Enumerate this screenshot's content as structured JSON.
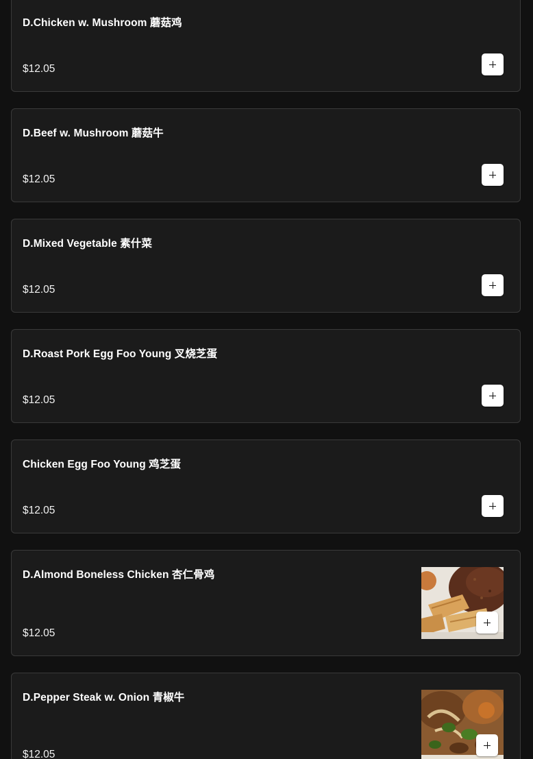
{
  "items": [
    {
      "name": "D.Chicken w. Mushroom 蘑菇鸡",
      "price": "$12.05",
      "has_image": false
    },
    {
      "name": "D.Beef w. Mushroom 蘑菇牛",
      "price": "$12.05",
      "has_image": false
    },
    {
      "name": "D.Mixed Vegetable 素什菜",
      "price": "$12.05",
      "has_image": false
    },
    {
      "name": "D.Roast Pork Egg Foo Young 叉烧芝蛋",
      "price": "$12.05",
      "has_image": false
    },
    {
      "name": "Chicken Egg Foo Young 鸡芝蛋",
      "price": "$12.05",
      "has_image": false
    },
    {
      "name": "D.Almond Boneless Chicken 杏仁骨鸡",
      "price": "$12.05",
      "has_image": true,
      "image": "egg-rolls-fried-rice-photo"
    },
    {
      "name": "D.Pepper Steak w. Onion 青椒牛",
      "price": "$12.05",
      "has_image": true,
      "image": "pepper-steak-photo"
    }
  ],
  "colors": {
    "background": "#111111",
    "card": "#1b1b1b",
    "card_border": "#3a3a3a",
    "add_button": "#ffffff"
  },
  "icons": {
    "add": "plus-icon"
  }
}
